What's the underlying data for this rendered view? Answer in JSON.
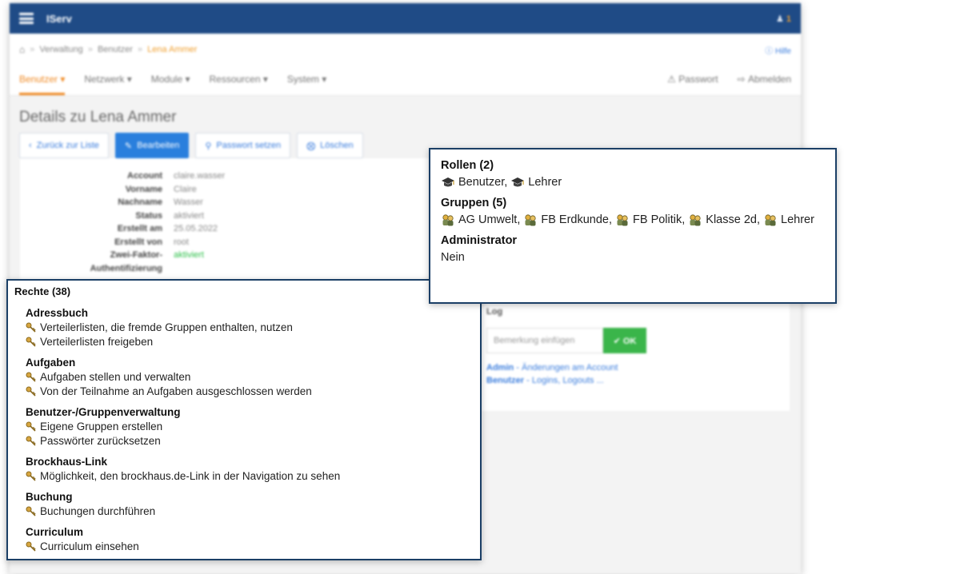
{
  "app": {
    "brand": "IServ",
    "user_icon_text": "♟",
    "user_badge": "1"
  },
  "breadcrumb": {
    "items": [
      "Verwaltung",
      "Benutzer"
    ],
    "current": "Lena Ammer",
    "help": "Hilfe"
  },
  "nav": {
    "items": [
      "Benutzer ▾",
      "Netzwerk ▾",
      "Module ▾",
      "Ressourcen ▾",
      "System ▾"
    ],
    "password": "Passwort",
    "logout": "Abmelden"
  },
  "page": {
    "title": "Details zu Lena Ammer"
  },
  "actions": {
    "back": "Zurück zur Liste",
    "edit": "Bearbeiten",
    "set_password": "Passwort setzen",
    "delete": "Löschen"
  },
  "details": {
    "rows": [
      {
        "label": "Account",
        "value": "claire.wasser"
      },
      {
        "label": "Vorname",
        "value": "Claire"
      },
      {
        "label": "Nachname",
        "value": "Wasser"
      },
      {
        "label": "Status",
        "value": "aktiviert"
      },
      {
        "label": "Erstellt am",
        "value": "25.05.2022"
      },
      {
        "label": "Erstellt von",
        "value": "root"
      },
      {
        "label": "Zwei-Faktor-",
        "value": "aktiviert"
      },
      {
        "label": "Authentifizierung",
        "value": ""
      }
    ]
  },
  "log": {
    "title": "Log",
    "placeholder": "Bemerkung einfügen",
    "ok": "✔ OK",
    "links": [
      {
        "bold": "Admin",
        "text": " - Änderungen am Account"
      },
      {
        "bold": "Benutzer",
        "text": " - Logins, Logouts ..."
      }
    ]
  },
  "rechte": {
    "title": "Rechte (38)",
    "sections": [
      {
        "heading": "Adressbuch",
        "items": [
          "Verteilerlisten, die fremde Gruppen enthalten, nutzen",
          "Verteilerlisten freigeben"
        ]
      },
      {
        "heading": "Aufgaben",
        "items": [
          "Aufgaben stellen und verwalten",
          "Von der Teilnahme an Aufgaben ausgeschlossen werden"
        ]
      },
      {
        "heading": "Benutzer-/Gruppenverwaltung",
        "items": [
          "Eigene Gruppen erstellen",
          "Passwörter zurücksetzen"
        ]
      },
      {
        "heading": "Brockhaus-Link",
        "items": [
          "Möglichkeit, den brockhaus.de-Link in der Navigation zu sehen"
        ]
      },
      {
        "heading": "Buchung",
        "items": [
          "Buchungen durchführen"
        ]
      },
      {
        "heading": "Curriculum",
        "items": [
          "Curriculum einsehen"
        ]
      }
    ]
  },
  "roles": {
    "rollen_title": "Rollen (2)",
    "rollen": [
      "Benutzer,",
      "Lehrer"
    ],
    "gruppen_title": "Gruppen (5)",
    "gruppen": [
      "AG Umwelt,",
      "FB Erdkunde,",
      "FB Politik,",
      "Klasse 2d,",
      "Lehrer"
    ],
    "admin_title": "Administrator",
    "admin_value": "Nein"
  }
}
